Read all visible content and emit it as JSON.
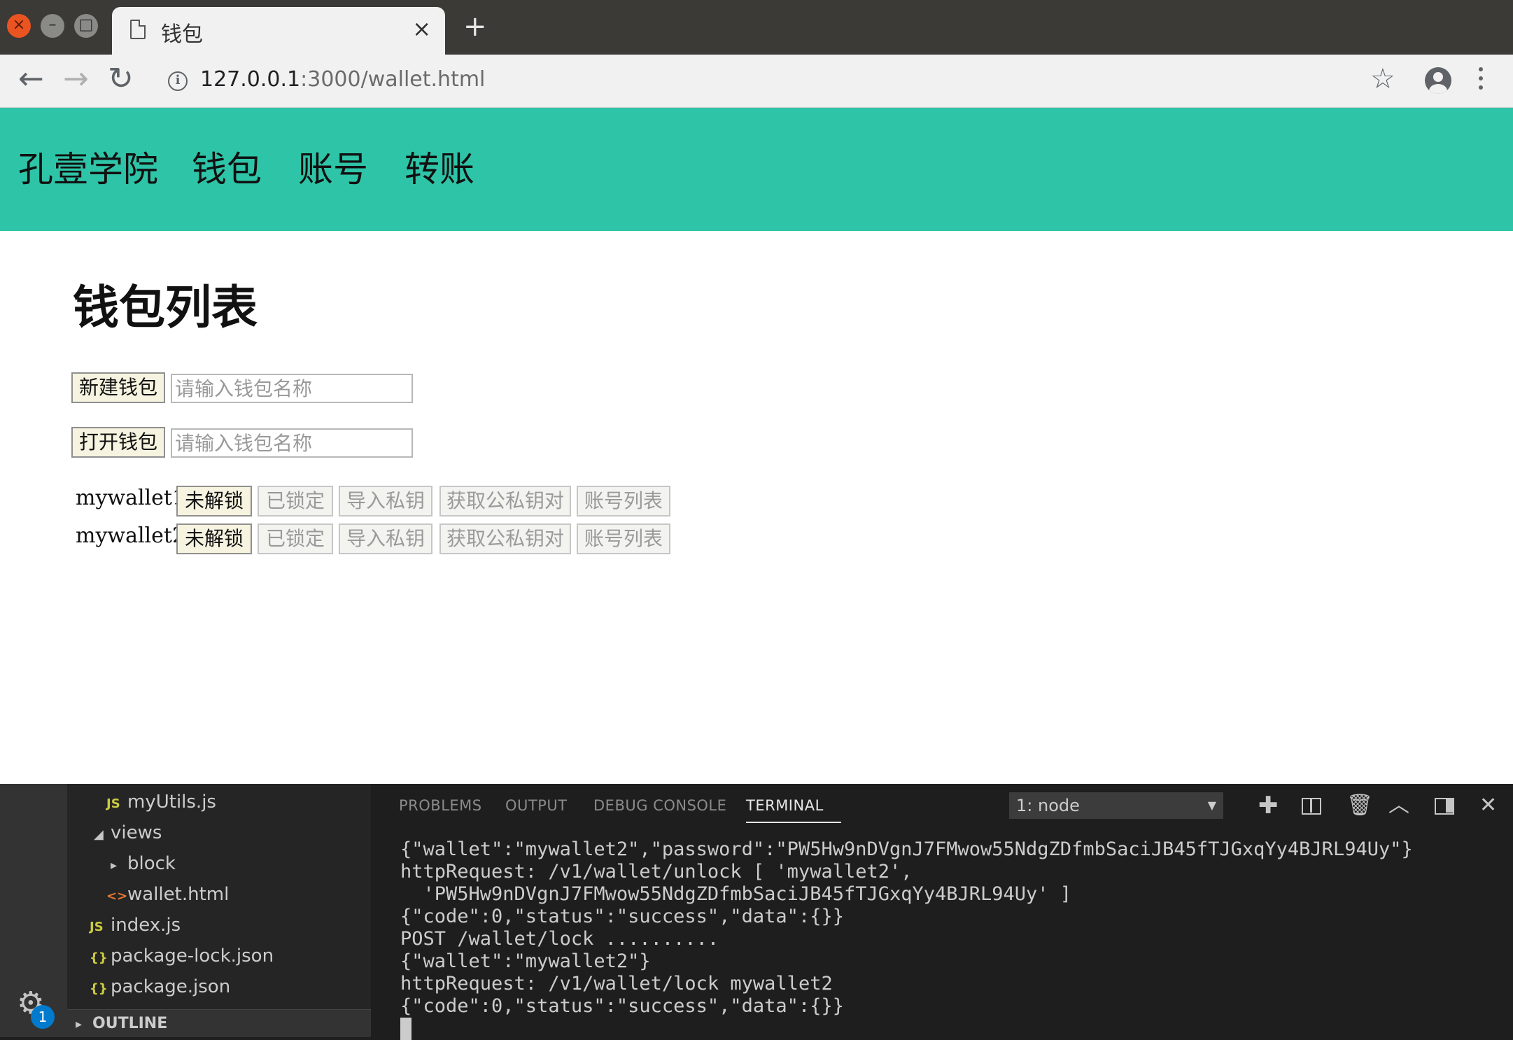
{
  "browser": {
    "tab_title": "钱包",
    "tab_close": "×",
    "new_tab": "+",
    "url_host": "127.0.0.1",
    "url_path": ":3000/wallet.html",
    "info_glyph": "i"
  },
  "navbar": {
    "brand": "孔壹学院",
    "items": [
      "钱包",
      "账号",
      "转账"
    ]
  },
  "main": {
    "title": "钱包列表",
    "new_wallet": {
      "button": "新建钱包",
      "placeholder": "请输入钱包名称"
    },
    "open_wallet": {
      "button": "打开钱包",
      "placeholder": "请输入钱包名称"
    },
    "wallets": [
      {
        "name": "mywallet1",
        "actions": [
          "未解锁",
          "已锁定",
          "导入私钥",
          "获取公私钥对",
          "账号列表"
        ]
      },
      {
        "name": "mywallet2",
        "actions": [
          "未解锁",
          "已锁定",
          "导入私钥",
          "获取公私钥对",
          "账号列表"
        ]
      }
    ]
  },
  "vscode": {
    "explorer": [
      {
        "label": "myUtils.js",
        "icon": "JS"
      },
      {
        "label": "views"
      },
      {
        "label": "block"
      },
      {
        "label": "wallet.html",
        "icon": "<>"
      },
      {
        "label": "index.js",
        "icon": "JS"
      },
      {
        "label": "package-lock.json",
        "icon": "{}"
      },
      {
        "label": "package.json",
        "icon": "{}"
      }
    ],
    "outline": "OUTLINE",
    "badge": "1",
    "panel_tabs": [
      "PROBLEMS",
      "OUTPUT",
      "DEBUG CONSOLE",
      "TERMINAL"
    ],
    "terminal_select": "1: node",
    "terminal_lines": [
      "{\"wallet\":\"mywallet2\",\"password\":\"PW5Hw9nDVgnJ7FMwow55NdgZDfmbSaciJB45fTJGxqYy4BJRL94Uy\"}",
      "httpRequest: /v1/wallet/unlock [ 'mywallet2',",
      "  'PW5Hw9nDVgnJ7FMwow55NdgZDfmbSaciJB45fTJGxqYy4BJRL94Uy' ]",
      "{\"code\":0,\"status\":\"success\",\"data\":{}}",
      "POST /wallet/lock ..........",
      "{\"wallet\":\"mywallet2\"}",
      "httpRequest: /v1/wallet/lock mywallet2",
      "{\"code\":0,\"status\":\"success\",\"data\":{}}"
    ]
  }
}
